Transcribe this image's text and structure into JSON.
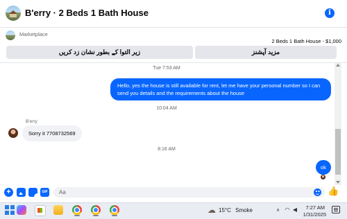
{
  "header": {
    "title": "B'erry · 2 Beds 1 Bath House",
    "info_icon": "info-icon"
  },
  "marketplace": {
    "label": "Marketplace",
    "listing": "2 Beds 1 Bath House - $1,000",
    "button_left": "زیر التوا کے بطور نشان زد کریں",
    "button_right": "مزید آپشنز"
  },
  "messages": {
    "time_1": "Tue 7:53 AM",
    "outgoing_1": "Hello, yes the house is still available for rent, let me have your personal number so I can send you details and the requirements about the house",
    "time_2": "10:04 AM",
    "incoming_sender": "B'erry",
    "incoming_1": "Sorry it 7708732569",
    "time_3": "8:16 AM",
    "outgoing_2": "ok"
  },
  "composer": {
    "placeholder": "Aa",
    "icons": [
      "plus-icon",
      "photo-icon",
      "sticker-icon",
      "gif-icon",
      "emoji-icon",
      "like-icon"
    ]
  },
  "taskbar": {
    "weather_temp": "15°C",
    "weather_condition": "Smoke",
    "time": "7:27 AM",
    "date": "1/31/2025"
  },
  "colors": {
    "accent": "#0866ff",
    "bubble_in": "#f0f2f5",
    "button_bg": "#e4e6eb"
  }
}
